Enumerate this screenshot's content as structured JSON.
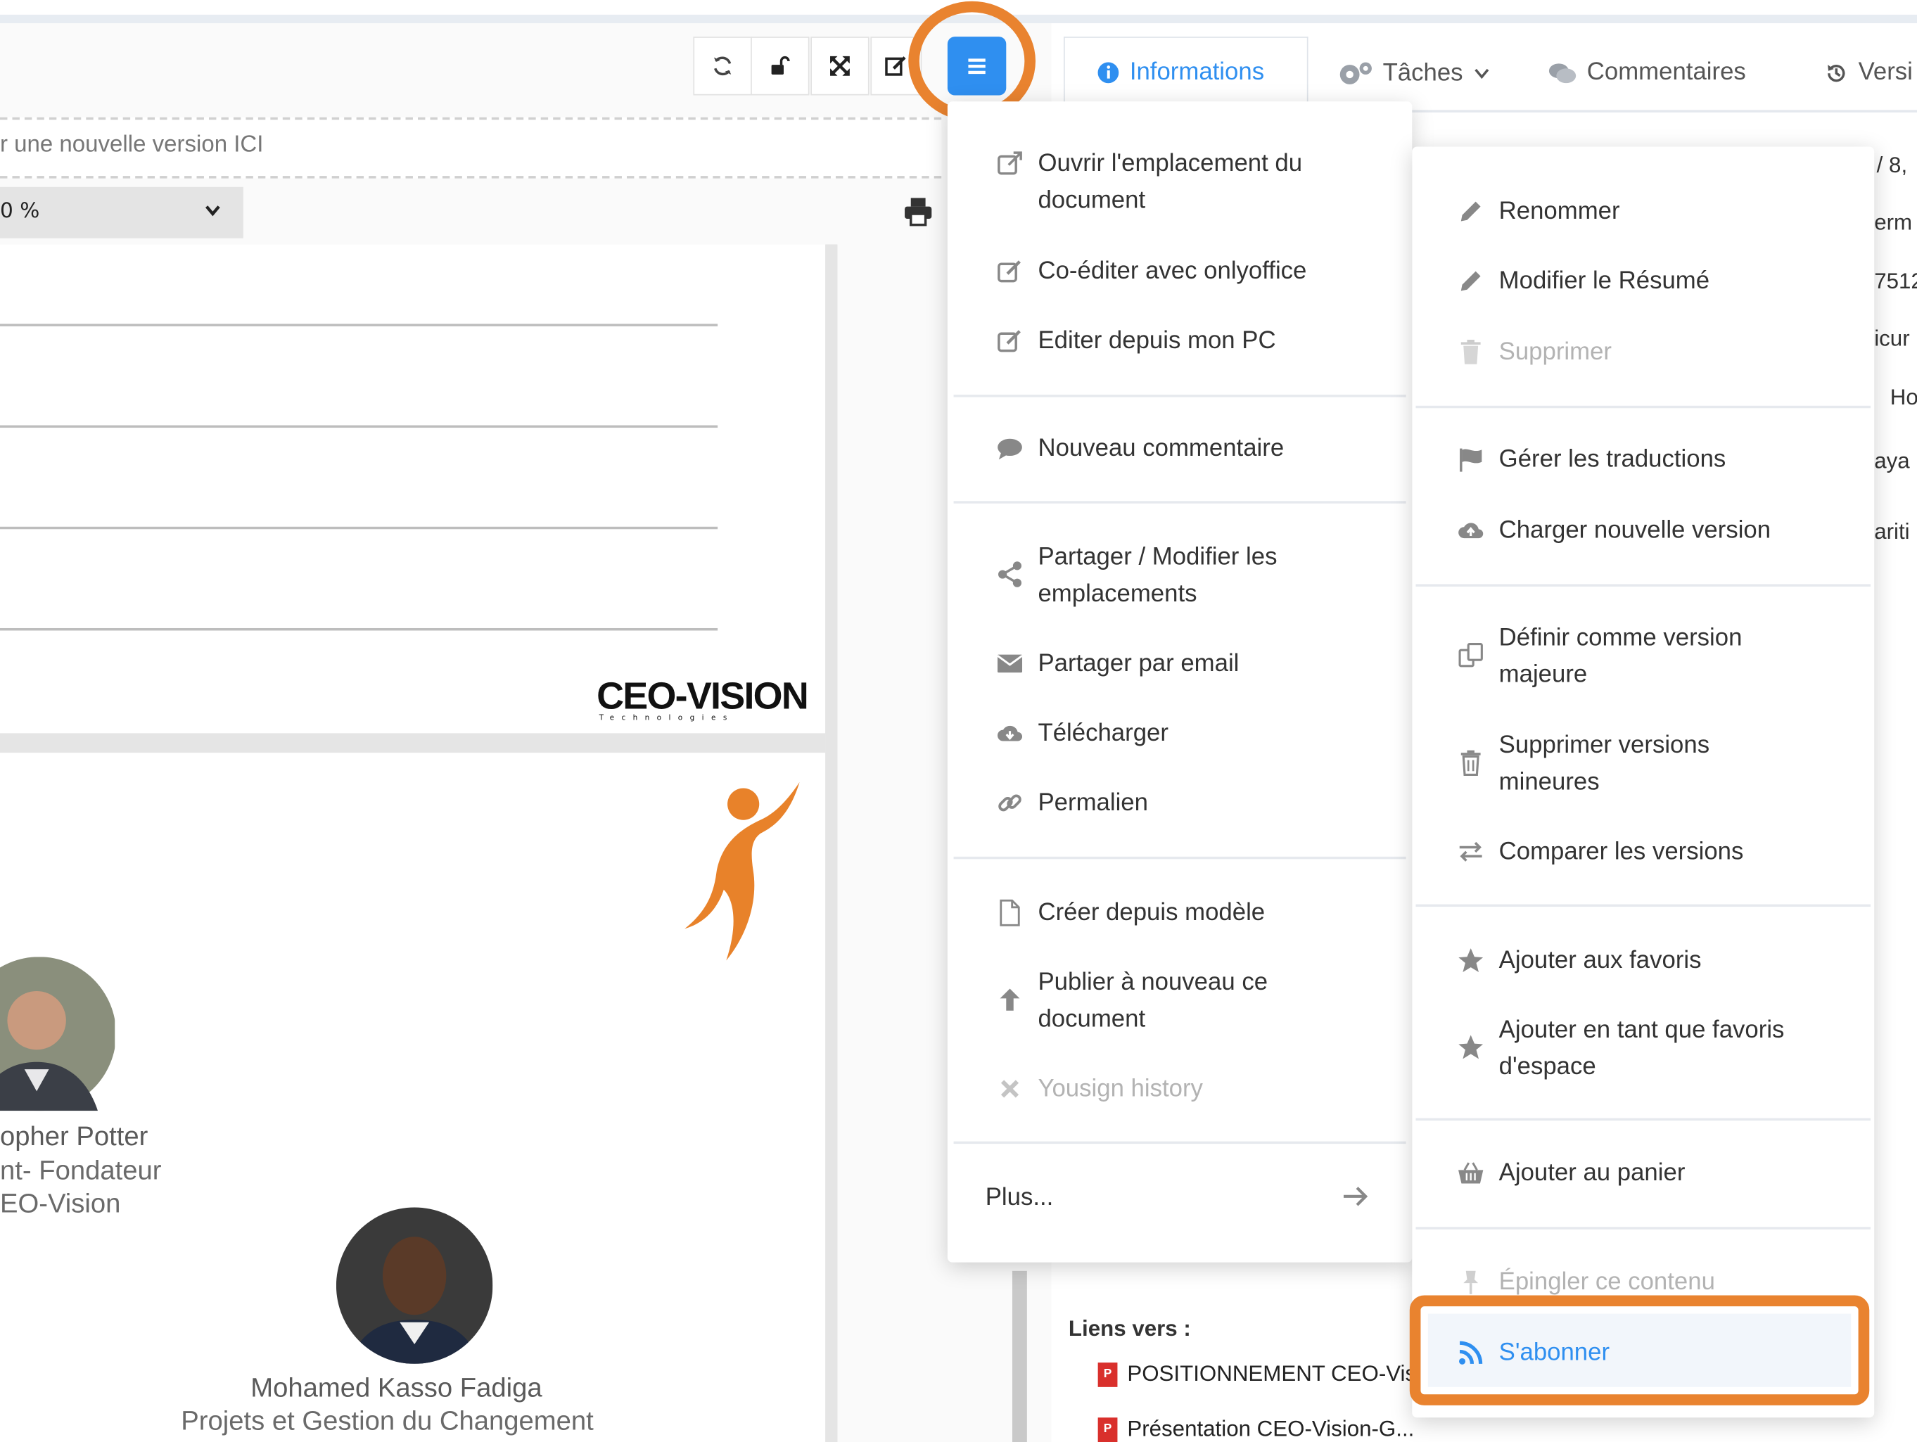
{
  "viewer": {
    "upload_hint": "r une nouvelle version ICI",
    "zoom_value": "0 %",
    "logo_text": "CEO-VISION",
    "logo_subtext": "Technologies",
    "people": [
      {
        "name": "opher Potter",
        "role": "nt- Fondateur",
        "org": "EO-Vision"
      },
      {
        "name": "Mohamed Kasso Fadiga",
        "role": "Projets et Gestion du Changement"
      }
    ]
  },
  "toolbar": {
    "buttons": [
      "refresh-icon",
      "unlock-icon",
      "fullscreen-icon",
      "edit-icon"
    ],
    "menu_icon": "hamburger-icon"
  },
  "tabs": [
    {
      "label": "Informations",
      "icon": "info-icon",
      "active": true
    },
    {
      "label": "Tâches",
      "icon": "gears-icon"
    },
    {
      "label": "Commentaires",
      "icon": "comments-icon"
    },
    {
      "label": "Versi",
      "icon": "history-icon"
    }
  ],
  "panel_partial": {
    "lines": [
      "/ 8,",
      "erm",
      "7512",
      "icur",
      "Ho",
      "aya",
      "ariti"
    ]
  },
  "links": {
    "label": "Liens vers :",
    "items": [
      "POSITIONNEMENT CEO-Vis",
      "Présentation CEO-Vision-G..."
    ]
  },
  "menu_left": {
    "items": [
      {
        "label": "Ouvrir l'emplacement du",
        "label2": "document",
        "icon": "external-link-icon"
      },
      {
        "label": "Co-éditer avec onlyoffice",
        "icon": "edit-icon"
      },
      {
        "label": "Editer depuis mon PC",
        "icon": "edit-icon"
      },
      {
        "label": "Nouveau commentaire",
        "icon": "comment-icon"
      },
      {
        "label": "Partager / Modifier les",
        "label2": "emplacements",
        "icon": "share-icon"
      },
      {
        "label": "Partager par email",
        "icon": "envelope-icon"
      },
      {
        "label": "Télécharger",
        "icon": "cloud-download-icon"
      },
      {
        "label": "Permalien",
        "icon": "link-icon"
      },
      {
        "label": "Créer depuis modèle",
        "icon": "file-icon"
      },
      {
        "label": "Publier à nouveau ce",
        "label2": "document",
        "icon": "arrow-up-icon"
      },
      {
        "label": "Yousign history",
        "icon": "close-icon",
        "disabled": true
      }
    ],
    "more_label": "Plus...",
    "more_icon": "arrow-right-icon"
  },
  "menu_right": {
    "items": [
      {
        "label": "Renommer",
        "icon": "pencil-icon"
      },
      {
        "label": "Modifier le Résumé",
        "icon": "pencil-icon"
      },
      {
        "label": "Supprimer",
        "icon": "trash-icon",
        "disabled": true
      },
      {
        "label": "Gérer les traductions",
        "icon": "flag-icon"
      },
      {
        "label": "Charger nouvelle version",
        "icon": "cloud-upload-icon"
      },
      {
        "label": "Définir comme version",
        "label2": "majeure",
        "icon": "copy-icon"
      },
      {
        "label": "Supprimer versions",
        "label2": "mineures",
        "icon": "trash-icon"
      },
      {
        "label": "Comparer les versions",
        "icon": "exchange-icon"
      },
      {
        "label": "Ajouter aux favoris",
        "icon": "star-icon"
      },
      {
        "label": "Ajouter en tant que favoris",
        "label2": "d'espace",
        "icon": "star-icon"
      },
      {
        "label": "Ajouter au panier",
        "icon": "basket-icon"
      },
      {
        "label": "Épingler ce contenu",
        "icon": "pin-icon",
        "disabled": true
      },
      {
        "label": "S'abonner",
        "icon": "rss-icon",
        "active": true
      }
    ]
  },
  "colors": {
    "accent": "#2f8ff0",
    "highlight": "#e9832f",
    "disabled": "#b3b3b3"
  }
}
